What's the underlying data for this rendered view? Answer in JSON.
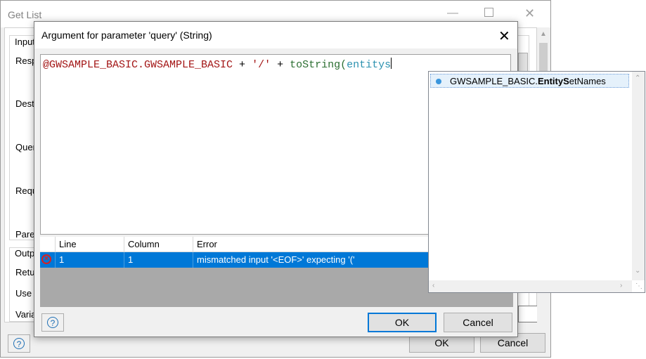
{
  "back_window": {
    "title": "Get List",
    "side_labels": [
      "Input",
      "Resp",
      "Dest",
      "Quer",
      "Requ",
      "Pare",
      "Outp",
      "Retu",
      "Use r",
      "Varia"
    ],
    "ok_label": "OK",
    "cancel_label": "Cancel",
    "help_glyph": "?"
  },
  "dialog": {
    "title": "Argument for parameter 'query' (String)",
    "close_glyph": "✕",
    "expression": {
      "tokens": [
        {
          "text": "@GWSAMPLE_BASIC.GWSAMPLE_BASIC",
          "kind": "red"
        },
        {
          "text": " + ",
          "kind": "op"
        },
        {
          "text": "'/'",
          "kind": "red"
        },
        {
          "text": " + ",
          "kind": "op"
        },
        {
          "text": "toString",
          "kind": "fn"
        },
        {
          "text": "(",
          "kind": "fn"
        },
        {
          "text": "entitys",
          "kind": "id"
        }
      ]
    },
    "errors": {
      "columns": [
        "Line",
        "Column",
        "Error"
      ],
      "rows": [
        {
          "line": "1",
          "column": "1",
          "error": "mismatched input '<EOF>' expecting '('"
        }
      ]
    },
    "ok_label": "OK",
    "cancel_label": "Cancel",
    "help_glyph": "?"
  },
  "autocomplete": {
    "items": [
      {
        "prefix": "GWSAMPLE_BASIC.",
        "bold": "EntityS",
        "suffix": "etNames"
      }
    ]
  },
  "colors": {
    "selection": "#0078d7",
    "string_literal": "#a31515",
    "function": "#2b6e31",
    "identifier": "#2b91af",
    "error_icon": "#d92020"
  }
}
